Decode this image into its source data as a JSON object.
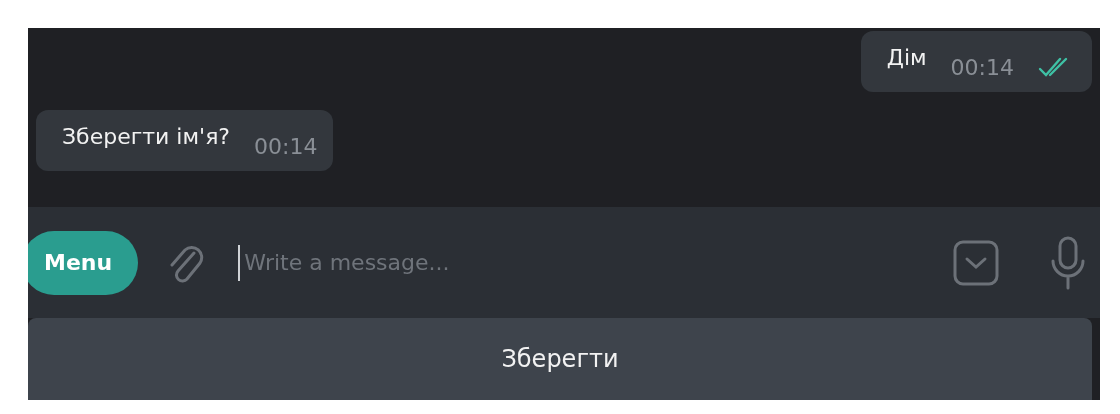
{
  "messages": [
    {
      "kind": "outgoing",
      "text": "Дім",
      "time": "00:14",
      "read": true
    },
    {
      "kind": "incoming",
      "text": "Зберегти ім'я?",
      "time": "00:14"
    }
  ],
  "composer": {
    "menu_label": "Menu",
    "placeholder": "Write a message..."
  },
  "keyboard": {
    "buttons": [
      "Зберегти"
    ]
  }
}
